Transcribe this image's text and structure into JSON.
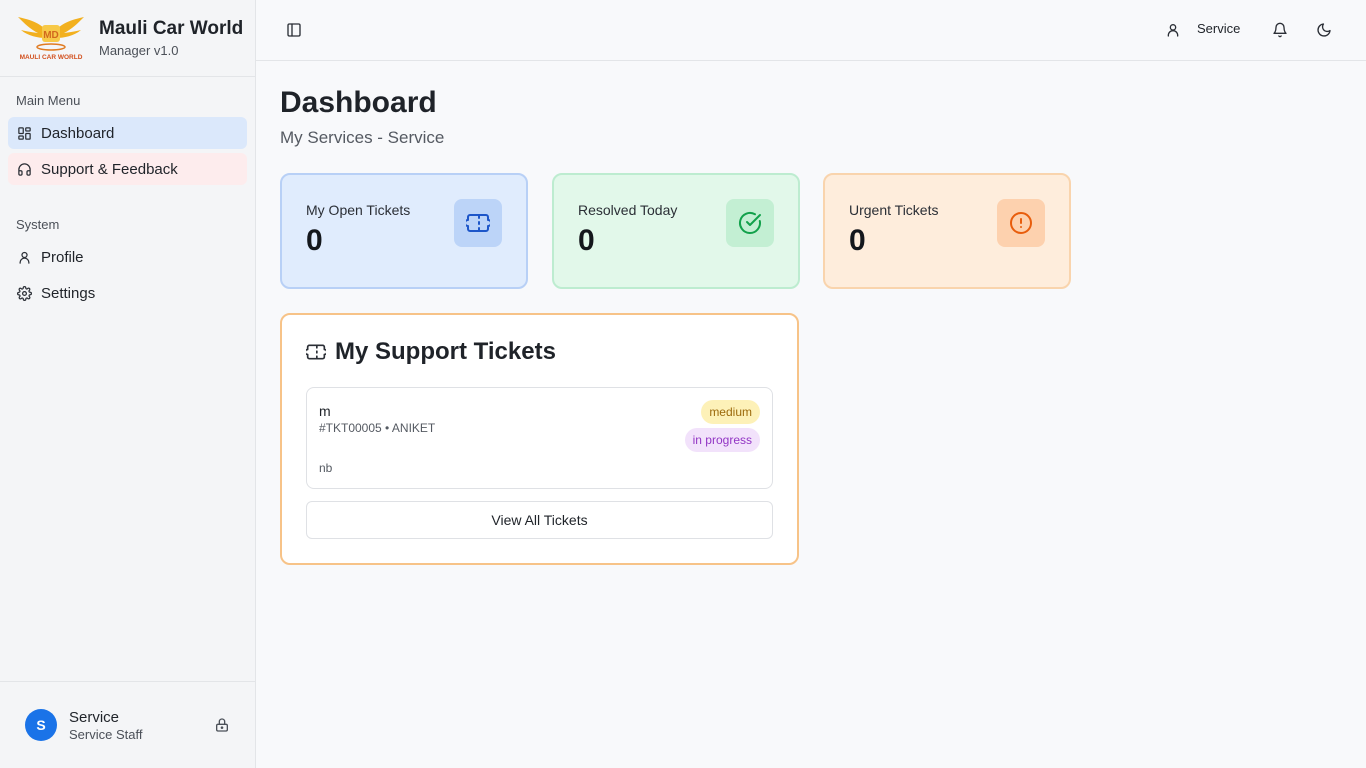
{
  "brand": {
    "name": "Mauli Car World",
    "version": "Manager v1.0",
    "logo_text": "MAULI CAR WORLD"
  },
  "sidebar": {
    "main_menu_label": "Main Menu",
    "main_items": [
      {
        "label": "Dashboard",
        "icon": "layout-grid-icon",
        "active": true
      },
      {
        "label": "Support & Feedback",
        "icon": "headphones-icon",
        "active": false
      }
    ],
    "system_label": "System",
    "system_items": [
      {
        "label": "Profile",
        "icon": "user-icon"
      },
      {
        "label": "Settings",
        "icon": "gear-icon"
      }
    ],
    "user": {
      "initial": "S",
      "name": "Service",
      "role": "Service Staff"
    }
  },
  "topbar": {
    "user_label": "Service"
  },
  "page": {
    "title": "Dashboard",
    "subtitle": "My Services - Service"
  },
  "stats": [
    {
      "label": "My Open Tickets",
      "value": "0",
      "icon": "ticket-icon",
      "color": "#1d56c9"
    },
    {
      "label": "Resolved Today",
      "value": "0",
      "icon": "check-circle-icon",
      "color": "#12a14b"
    },
    {
      "label": "Urgent Tickets",
      "value": "0",
      "icon": "alert-circle-icon",
      "color": "#e85d0c"
    }
  ],
  "tickets_card": {
    "title": "My Support Tickets",
    "tickets": [
      {
        "subject": "m",
        "meta": "#TKT00005 • ANIKET",
        "description": "nb",
        "priority": "medium",
        "status": "in progress"
      }
    ],
    "view_all_label": "View All Tickets"
  }
}
